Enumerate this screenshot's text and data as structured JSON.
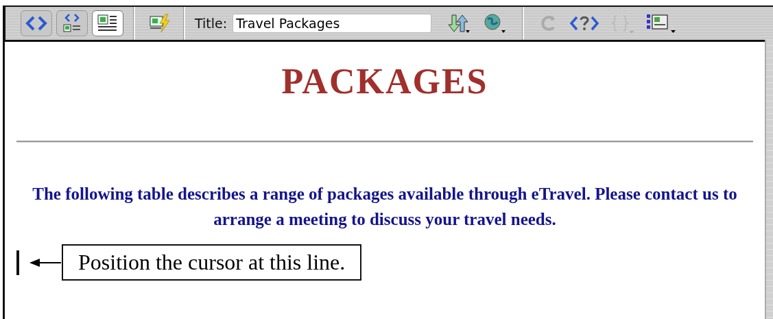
{
  "toolbar": {
    "view_buttons": [
      {
        "kind": "code",
        "selected": false
      },
      {
        "kind": "split",
        "selected": false
      },
      {
        "kind": "design",
        "selected": true
      }
    ],
    "title_label": "Title:",
    "title_field": {
      "value": "Travel Packages"
    }
  },
  "document": {
    "heading": "PACKAGES",
    "paragraph": "The following table describes a range of packages available through eTravel. Please contact us to arrange a meeting to discuss your travel needs."
  },
  "callout": {
    "text": "Position the cursor at this line."
  }
}
